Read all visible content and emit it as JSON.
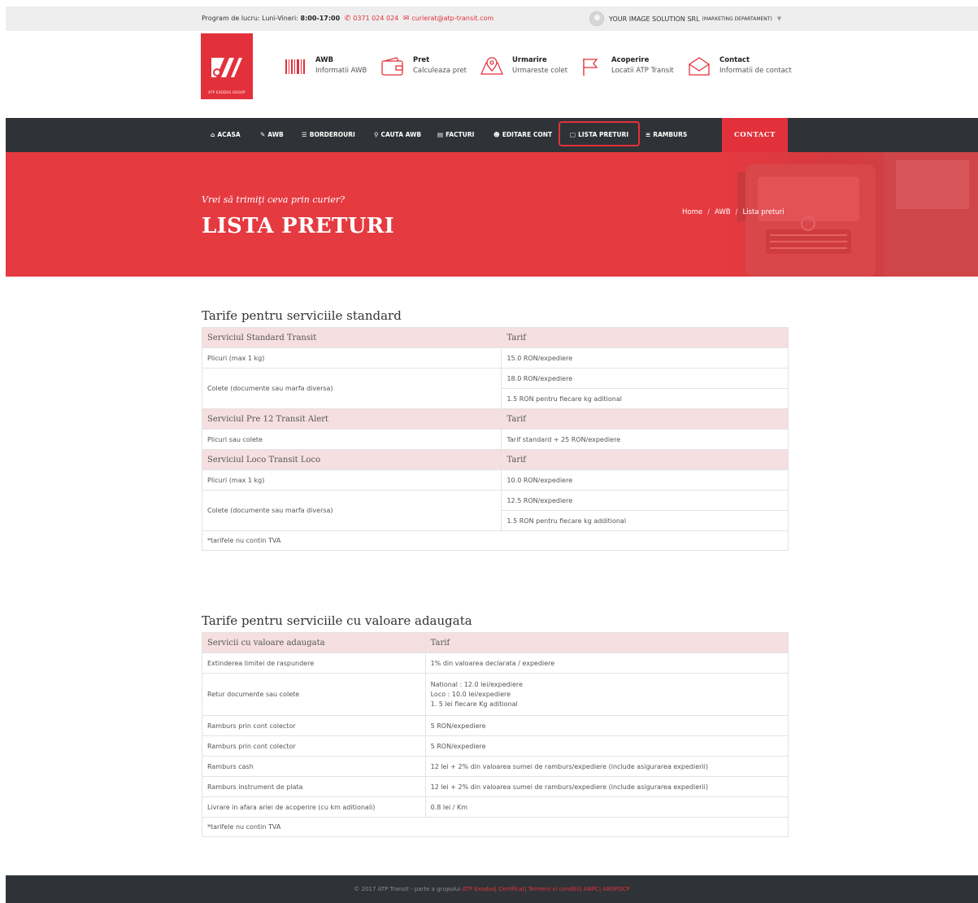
{
  "topbar": {
    "hours_label": "Program de lucru: Luni-Vineri:",
    "hours_value": "8:00-17:00",
    "phone": "0371 024 024",
    "email": "curierat@atp-transit.com",
    "user_name": "YOUR IMAGE SOLUTION SRL",
    "user_dept": "(MARKETING DEPARTAMENT)"
  },
  "header": {
    "logo_tagline": "ATP EXODUS GROUP",
    "items": [
      {
        "title": "AWB",
        "subtitle": "Informatii AWB",
        "icon": "barcode-icon"
      },
      {
        "title": "Pret",
        "subtitle": "Calculeaza pret",
        "icon": "wallet-icon"
      },
      {
        "title": "Urmarire",
        "subtitle": "Urmareste colet",
        "icon": "map-pin-icon"
      },
      {
        "title": "Acoperire",
        "subtitle": "Locatii ATP Transit",
        "icon": "flag-icon"
      },
      {
        "title": "Contact",
        "subtitle": "Informatii de contact",
        "icon": "envelope-icon"
      }
    ]
  },
  "nav": {
    "items": [
      {
        "label": "ACASA",
        "icon": "home-icon"
      },
      {
        "label": "AWB",
        "icon": "pencil-icon"
      },
      {
        "label": "BORDEROURI",
        "icon": "list-icon"
      },
      {
        "label": "CAUTA AWB",
        "icon": "search-icon"
      },
      {
        "label": "FACTURI",
        "icon": "invoice-icon"
      },
      {
        "label": "EDITARE CONT",
        "icon": "user-icon"
      },
      {
        "label": "LISTA PRETURI",
        "icon": "price-list-icon"
      },
      {
        "label": "RAMBURS",
        "icon": "menu-icon"
      }
    ],
    "contact_label": "CONTACT"
  },
  "hero": {
    "lead": "Vrei să trimiţi ceva prin curier?",
    "title": "LISTA PRETURI",
    "breadcrumb": [
      "Home",
      "AWB",
      "Lista preturi"
    ]
  },
  "standard": {
    "title": "Tarife pentru serviciile standard",
    "groups": [
      {
        "name": "Serviciul Standard Transit",
        "tarif_label": "Tarif",
        "rows": [
          {
            "service": "Plicuri (max 1 kg)",
            "prices": [
              "15.0 RON/expediere"
            ]
          },
          {
            "service": "Colete (documente sau marfa diversa)",
            "prices": [
              "18.0 RON/expediere",
              "1.5 RON pentru fiecare kg aditional"
            ]
          }
        ]
      },
      {
        "name": "Serviciul Pre 12 Transit Alert",
        "tarif_label": "Tarif",
        "rows": [
          {
            "service": "Plicuri sau colete",
            "prices": [
              "Tarif standard + 25 RON/expediere"
            ]
          }
        ]
      },
      {
        "name": "Serviciul Loco Transit Loco",
        "tarif_label": "Tarif",
        "rows": [
          {
            "service": "Plicuri (max 1 kg)",
            "prices": [
              "10.0 RON/expediere"
            ]
          },
          {
            "service": "Colete (documente sau marfa diversa)",
            "prices": [
              "12.5 RON/expediere",
              "1.5 RON pentru fiecare kg additional"
            ]
          }
        ]
      }
    ],
    "note": "*tarifele nu contin TVA"
  },
  "added": {
    "title": "Tarife pentru serviciile cu valoare adaugata",
    "header": [
      "Servicii cu valoare adaugata",
      "Tarif"
    ],
    "rows": [
      {
        "service": "Extinderea limitei de raspundere",
        "tarif": [
          "1% din valoarea declarata / expediere"
        ]
      },
      {
        "service": "Retur documente sau colete",
        "tarif": [
          "National : 12.0 lei/expediere",
          "Loco : 10.0 lei/expediere",
          "1. 5 lei fiecare Kg aditional"
        ]
      },
      {
        "service": "Ramburs prin cont colector",
        "tarif": [
          "5 RON/expediere"
        ]
      },
      {
        "service": "Ramburs prin cont colector",
        "tarif": [
          "5 RON/expediere"
        ]
      },
      {
        "service": "Ramburs cash",
        "tarif": [
          "12 lei + 2% din valoarea sumei de ramburs/expediere (include asigurarea expedierii)"
        ]
      },
      {
        "service": "Ramburs instrument de plata",
        "tarif": [
          "12 lei + 2% din valoarea sumei de ramburs/expediere (include asigurarea expedierii)"
        ]
      },
      {
        "service": "Livrare in afara ariei de acoperire (cu km aditionali)",
        "tarif": [
          "0.8 lei / Km"
        ]
      }
    ],
    "note": "*tarifele nu contin TVA"
  },
  "footer": {
    "text": "© 2017 ATP Transit - parte a grupului",
    "links": [
      "ATP Exodus",
      "Certificat",
      "Termeni si conditii",
      "ANPC",
      "ANSPDCP"
    ]
  }
}
